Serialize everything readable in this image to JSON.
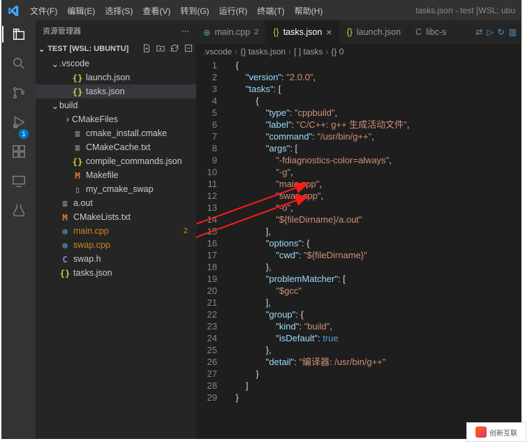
{
  "window": {
    "title": "tasks.json - test [WSL: ubu"
  },
  "menubar": [
    "文件(F)",
    "编辑(E)",
    "选择(S)",
    "查看(V)",
    "转到(G)",
    "运行(R)",
    "终端(T)",
    "帮助(H)"
  ],
  "activitybar": {
    "badge": "1"
  },
  "sidebar": {
    "title": "资源管理器",
    "section": "TEST [WSL: UBUNTU]",
    "tree": [
      {
        "depth": 1,
        "chev": "⌄",
        "icon": "",
        "iconCls": "",
        "label": ".vscode"
      },
      {
        "depth": 2,
        "chev": "",
        "icon": "{}",
        "iconCls": "ic-json",
        "label": "launch.json"
      },
      {
        "depth": 2,
        "chev": "",
        "icon": "{}",
        "iconCls": "ic-json",
        "label": "tasks.json",
        "active": true
      },
      {
        "depth": 1,
        "chev": "⌄",
        "icon": "",
        "iconCls": "",
        "label": "build"
      },
      {
        "depth": 2,
        "chev": "›",
        "icon": "",
        "iconCls": "",
        "label": "CMakeFiles"
      },
      {
        "depth": 2,
        "chev": "",
        "icon": "≡",
        "iconCls": "ic-txt",
        "label": "cmake_install.cmake"
      },
      {
        "depth": 2,
        "chev": "",
        "icon": "≡",
        "iconCls": "ic-txt",
        "label": "CMakeCache.txt"
      },
      {
        "depth": 2,
        "chev": "",
        "icon": "{}",
        "iconCls": "ic-json",
        "label": "compile_commands.json"
      },
      {
        "depth": 2,
        "chev": "",
        "icon": "M",
        "iconCls": "ic-m",
        "label": "Makefile"
      },
      {
        "depth": 2,
        "chev": "",
        "icon": "▯",
        "iconCls": "ic-txt",
        "label": "my_cmake_swap"
      },
      {
        "depth": 1,
        "chev": "",
        "icon": "≡",
        "iconCls": "ic-txt",
        "label": "a.out"
      },
      {
        "depth": 1,
        "chev": "",
        "icon": "M",
        "iconCls": "ic-m",
        "label": "CMakeLists.txt"
      },
      {
        "depth": 1,
        "chev": "",
        "icon": "⊕",
        "iconCls": "ic-cpp",
        "label": "main.cpp",
        "git": true,
        "gitBadge": "2"
      },
      {
        "depth": 1,
        "chev": "",
        "icon": "⊕",
        "iconCls": "ic-cpp",
        "label": "swap.cpp",
        "git": true
      },
      {
        "depth": 1,
        "chev": "",
        "icon": "C",
        "iconCls": "ic-h",
        "label": "swap.h"
      },
      {
        "depth": 1,
        "chev": "",
        "icon": "{}",
        "iconCls": "ic-json",
        "label": "tasks.json"
      }
    ]
  },
  "tabs": [
    {
      "icon": "⊕",
      "iconCls": "ic-cpp",
      "label": "main.cpp",
      "mod": "2"
    },
    {
      "icon": "{}",
      "iconCls": "ic-json",
      "label": "tasks.json",
      "active": true,
      "close": true
    },
    {
      "icon": "{}",
      "iconCls": "ic-json",
      "label": "launch.json"
    },
    {
      "icon": "C",
      "iconCls": "ic-h",
      "label": "libc-s"
    }
  ],
  "breadcrumbs": [
    ".vscode",
    "{} tasks.json",
    "[ ] tasks",
    "{} 0"
  ],
  "code": [
    {
      "n": 1,
      "seg": [
        {
          "c": "tk-punc",
          "t": "    {"
        }
      ]
    },
    {
      "n": 2,
      "seg": [
        {
          "c": "tk-punc",
          "t": "        "
        },
        {
          "c": "tk-key",
          "t": "\"version\""
        },
        {
          "c": "tk-punc",
          "t": ": "
        },
        {
          "c": "tk-str",
          "t": "\"2.0.0\""
        },
        {
          "c": "tk-punc",
          "t": ","
        }
      ]
    },
    {
      "n": 3,
      "seg": [
        {
          "c": "tk-punc",
          "t": "        "
        },
        {
          "c": "tk-key",
          "t": "\"tasks\""
        },
        {
          "c": "tk-punc",
          "t": ": ["
        }
      ]
    },
    {
      "n": 4,
      "seg": [
        {
          "c": "tk-punc",
          "t": "            {"
        }
      ]
    },
    {
      "n": 5,
      "seg": [
        {
          "c": "tk-punc",
          "t": "                "
        },
        {
          "c": "tk-key",
          "t": "\"type\""
        },
        {
          "c": "tk-punc",
          "t": ": "
        },
        {
          "c": "tk-str",
          "t": "\"cppbuild\""
        },
        {
          "c": "tk-punc",
          "t": ","
        }
      ]
    },
    {
      "n": 6,
      "seg": [
        {
          "c": "tk-punc",
          "t": "                "
        },
        {
          "c": "tk-key",
          "t": "\"label\""
        },
        {
          "c": "tk-punc",
          "t": ": "
        },
        {
          "c": "tk-str",
          "t": "\"C/C++: g++ 生成活动文件\""
        },
        {
          "c": "tk-punc",
          "t": ","
        }
      ]
    },
    {
      "n": 7,
      "seg": [
        {
          "c": "tk-punc",
          "t": "                "
        },
        {
          "c": "tk-key",
          "t": "\"command\""
        },
        {
          "c": "tk-punc",
          "t": ": "
        },
        {
          "c": "tk-str",
          "t": "\"/usr/bin/g++\""
        },
        {
          "c": "tk-punc",
          "t": ","
        }
      ]
    },
    {
      "n": 8,
      "seg": [
        {
          "c": "tk-punc",
          "t": "                "
        },
        {
          "c": "tk-key",
          "t": "\"args\""
        },
        {
          "c": "tk-punc",
          "t": ": ["
        }
      ]
    },
    {
      "n": 9,
      "seg": [
        {
          "c": "tk-punc",
          "t": "                    "
        },
        {
          "c": "tk-str",
          "t": "\"-fdiagnostics-color=always\""
        },
        {
          "c": "tk-punc",
          "t": ","
        }
      ]
    },
    {
      "n": 10,
      "seg": [
        {
          "c": "tk-punc",
          "t": "                    "
        },
        {
          "c": "tk-str",
          "t": "\"-g\""
        },
        {
          "c": "tk-punc",
          "t": ","
        }
      ]
    },
    {
      "n": 11,
      "seg": [
        {
          "c": "tk-punc",
          "t": "                    "
        },
        {
          "c": "tk-str",
          "t": "\"main.cpp\""
        },
        {
          "c": "tk-punc",
          "t": ","
        }
      ]
    },
    {
      "n": 12,
      "seg": [
        {
          "c": "tk-punc",
          "t": "                    "
        },
        {
          "c": "tk-str",
          "t": "\"swap.cpp\""
        },
        {
          "c": "tk-punc",
          "t": ","
        }
      ]
    },
    {
      "n": 13,
      "seg": [
        {
          "c": "tk-punc",
          "t": "                    "
        },
        {
          "c": "tk-str",
          "t": "\"-o\""
        },
        {
          "c": "tk-punc",
          "t": ","
        }
      ]
    },
    {
      "n": 14,
      "seg": [
        {
          "c": "tk-punc",
          "t": "                    "
        },
        {
          "c": "tk-str",
          "t": "\"${fileDirname}/a.out\""
        }
      ]
    },
    {
      "n": 15,
      "seg": [
        {
          "c": "tk-punc",
          "t": "                ],"
        }
      ]
    },
    {
      "n": 16,
      "seg": [
        {
          "c": "tk-punc",
          "t": "                "
        },
        {
          "c": "tk-key",
          "t": "\"options\""
        },
        {
          "c": "tk-punc",
          "t": ": {"
        }
      ]
    },
    {
      "n": 17,
      "seg": [
        {
          "c": "tk-punc",
          "t": "                    "
        },
        {
          "c": "tk-key",
          "t": "\"cwd\""
        },
        {
          "c": "tk-punc",
          "t": ": "
        },
        {
          "c": "tk-str",
          "t": "\"${fileDirname}\""
        }
      ]
    },
    {
      "n": 18,
      "seg": [
        {
          "c": "tk-punc",
          "t": "                },"
        }
      ]
    },
    {
      "n": 19,
      "seg": [
        {
          "c": "tk-punc",
          "t": "                "
        },
        {
          "c": "tk-key",
          "t": "\"problemMatcher\""
        },
        {
          "c": "tk-punc",
          "t": ": ["
        }
      ]
    },
    {
      "n": 20,
      "seg": [
        {
          "c": "tk-punc",
          "t": "                    "
        },
        {
          "c": "tk-str",
          "t": "\"$gcc\""
        }
      ]
    },
    {
      "n": 21,
      "seg": [
        {
          "c": "tk-punc",
          "t": "                ],"
        }
      ]
    },
    {
      "n": 22,
      "seg": [
        {
          "c": "tk-punc",
          "t": "                "
        },
        {
          "c": "tk-key",
          "t": "\"group\""
        },
        {
          "c": "tk-punc",
          "t": ": {"
        }
      ]
    },
    {
      "n": 23,
      "seg": [
        {
          "c": "tk-punc",
          "t": "                    "
        },
        {
          "c": "tk-key",
          "t": "\"kind\""
        },
        {
          "c": "tk-punc",
          "t": ": "
        },
        {
          "c": "tk-str",
          "t": "\"build\""
        },
        {
          "c": "tk-punc",
          "t": ","
        }
      ]
    },
    {
      "n": 24,
      "seg": [
        {
          "c": "tk-punc",
          "t": "                    "
        },
        {
          "c": "tk-key",
          "t": "\"isDefault\""
        },
        {
          "c": "tk-punc",
          "t": ": "
        },
        {
          "c": "tk-true",
          "t": "true"
        }
      ]
    },
    {
      "n": 25,
      "seg": [
        {
          "c": "tk-punc",
          "t": "                },"
        }
      ]
    },
    {
      "n": 26,
      "seg": [
        {
          "c": "tk-punc",
          "t": "                "
        },
        {
          "c": "tk-key",
          "t": "\"detail\""
        },
        {
          "c": "tk-punc",
          "t": ": "
        },
        {
          "c": "tk-str",
          "t": "\"编译器: /usr/bin/g++\""
        }
      ]
    },
    {
      "n": 27,
      "seg": [
        {
          "c": "tk-punc",
          "t": "            }"
        }
      ]
    },
    {
      "n": 28,
      "seg": [
        {
          "c": "tk-punc",
          "t": "        ]"
        }
      ]
    },
    {
      "n": 29,
      "seg": [
        {
          "c": "tk-punc",
          "t": "    }"
        }
      ]
    }
  ],
  "watermark": "创新互联"
}
